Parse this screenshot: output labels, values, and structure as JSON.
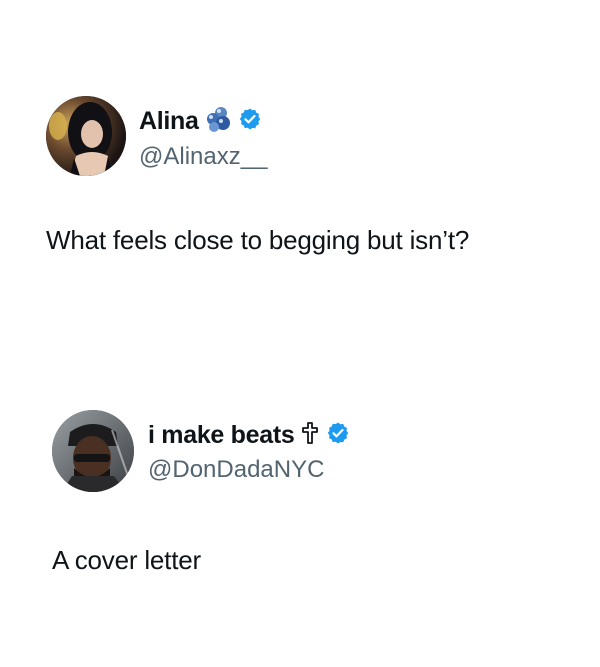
{
  "tweets": [
    {
      "display_name": "Alina",
      "name_emoji": "blue-blob-cluster-icon",
      "verified": true,
      "handle": "@Alinaxz__",
      "text": "What feels close to begging but isn’t?"
    },
    {
      "display_name": "i make beats",
      "name_emoji": "cross-icon",
      "verified": true,
      "handle": "@DonDadaNYC",
      "text": "A cover letter"
    }
  ],
  "colors": {
    "text": "#0f1419",
    "handle": "#536471",
    "verified_badge": "#1d9bf0",
    "background": "#ffffff"
  }
}
